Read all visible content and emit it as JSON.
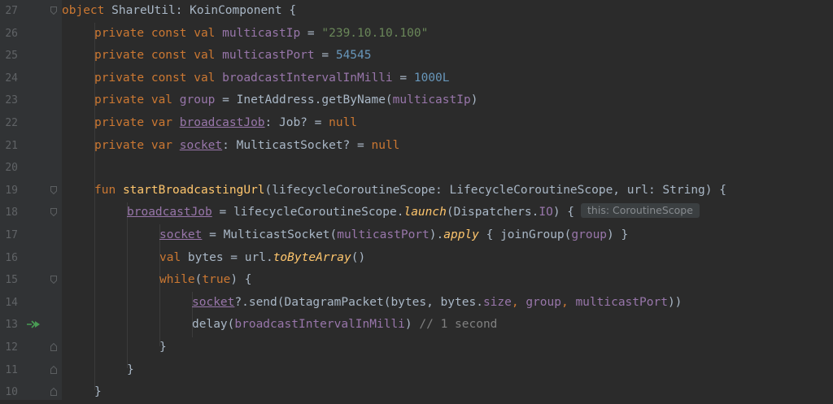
{
  "gutter": {
    "line_numbers": [
      "27",
      "26",
      "25",
      "24",
      "23",
      "22",
      "21",
      "20",
      "19",
      "18",
      "17",
      "16",
      "15",
      "14",
      "13",
      "12",
      "11",
      "10"
    ]
  },
  "code": {
    "l27": {
      "kw": "object",
      "rest": " ShareUtil: KoinComponent {"
    },
    "l26": {
      "kw": "private const val",
      "prop": "multicastIp",
      "eq": " = ",
      "str": "\"239.10.10.100\""
    },
    "l25": {
      "kw": "private const val",
      "prop": "multicastPort",
      "eq": " = ",
      "num": "54545"
    },
    "l24": {
      "kw": "private const val",
      "prop": "broadcastIntervalInMilli",
      "eq": " = ",
      "num": "1000L"
    },
    "l23": {
      "kw": "private val",
      "prop": "group",
      "mid": " = InetAddress.getByName(",
      "arg": "multicastIp",
      "end": ")"
    },
    "l22": {
      "kw": "private var",
      "prop": "broadcastJob",
      "mid": ": Job? = ",
      "null": "null"
    },
    "l21": {
      "kw": "private var",
      "prop": "socket",
      "mid": ": MulticastSocket? = ",
      "null": "null"
    },
    "l19": {
      "kw": "fun",
      "fn": "startBroadcastingUrl",
      "params": "(lifecycleCoroutineScope: LifecycleCoroutineScope, url: String) {"
    },
    "l18": {
      "prop": "broadcastJob",
      "mid": " = lifecycleCoroutineScope.",
      "call": "launch",
      "args": "(Dispatchers.",
      "io": "IO",
      "end": ") {",
      "hint": "this: CoroutineScope"
    },
    "l17": {
      "prop": "socket",
      "mid": " = MulticastSocket(",
      "arg": "multicastPort",
      "mid2": ").",
      "call": "apply",
      "mid3": " { joinGroup(",
      "arg2": "group",
      "end": ") }"
    },
    "l16": {
      "kw": "val",
      "mid": " bytes = url.",
      "call": "toByteArray",
      "end": "()"
    },
    "l15": {
      "kw": "while",
      "open": "(",
      "kw2": "true",
      "end": ") {"
    },
    "l14": {
      "prop": "socket",
      "mid": "?.send(DatagramPacket(bytes, bytes.",
      "prop2": "size",
      "sep": ", ",
      "prop3": "group",
      "sep2": ", ",
      "prop4": "multicastPort",
      "end": "))"
    },
    "l13": {
      "mid": "delay(",
      "prop": "broadcastIntervalInMilli",
      "end": ") ",
      "cmt": "// 1 second"
    },
    "l12": {
      "end": "}"
    },
    "l11": {
      "end": "}"
    },
    "l10": {
      "end": "}"
    }
  },
  "colors": {
    "background": "#2b2b2b",
    "gutter": "#313335",
    "keyword": "#cc7832",
    "string": "#6a8759",
    "number": "#6897bb",
    "property": "#9876aa",
    "function": "#ffc66d",
    "comment": "#808080",
    "text": "#a9b7c6"
  },
  "icons": {
    "fold": "fold-marker-icon",
    "run": "breakpoint-arrow-icon"
  }
}
